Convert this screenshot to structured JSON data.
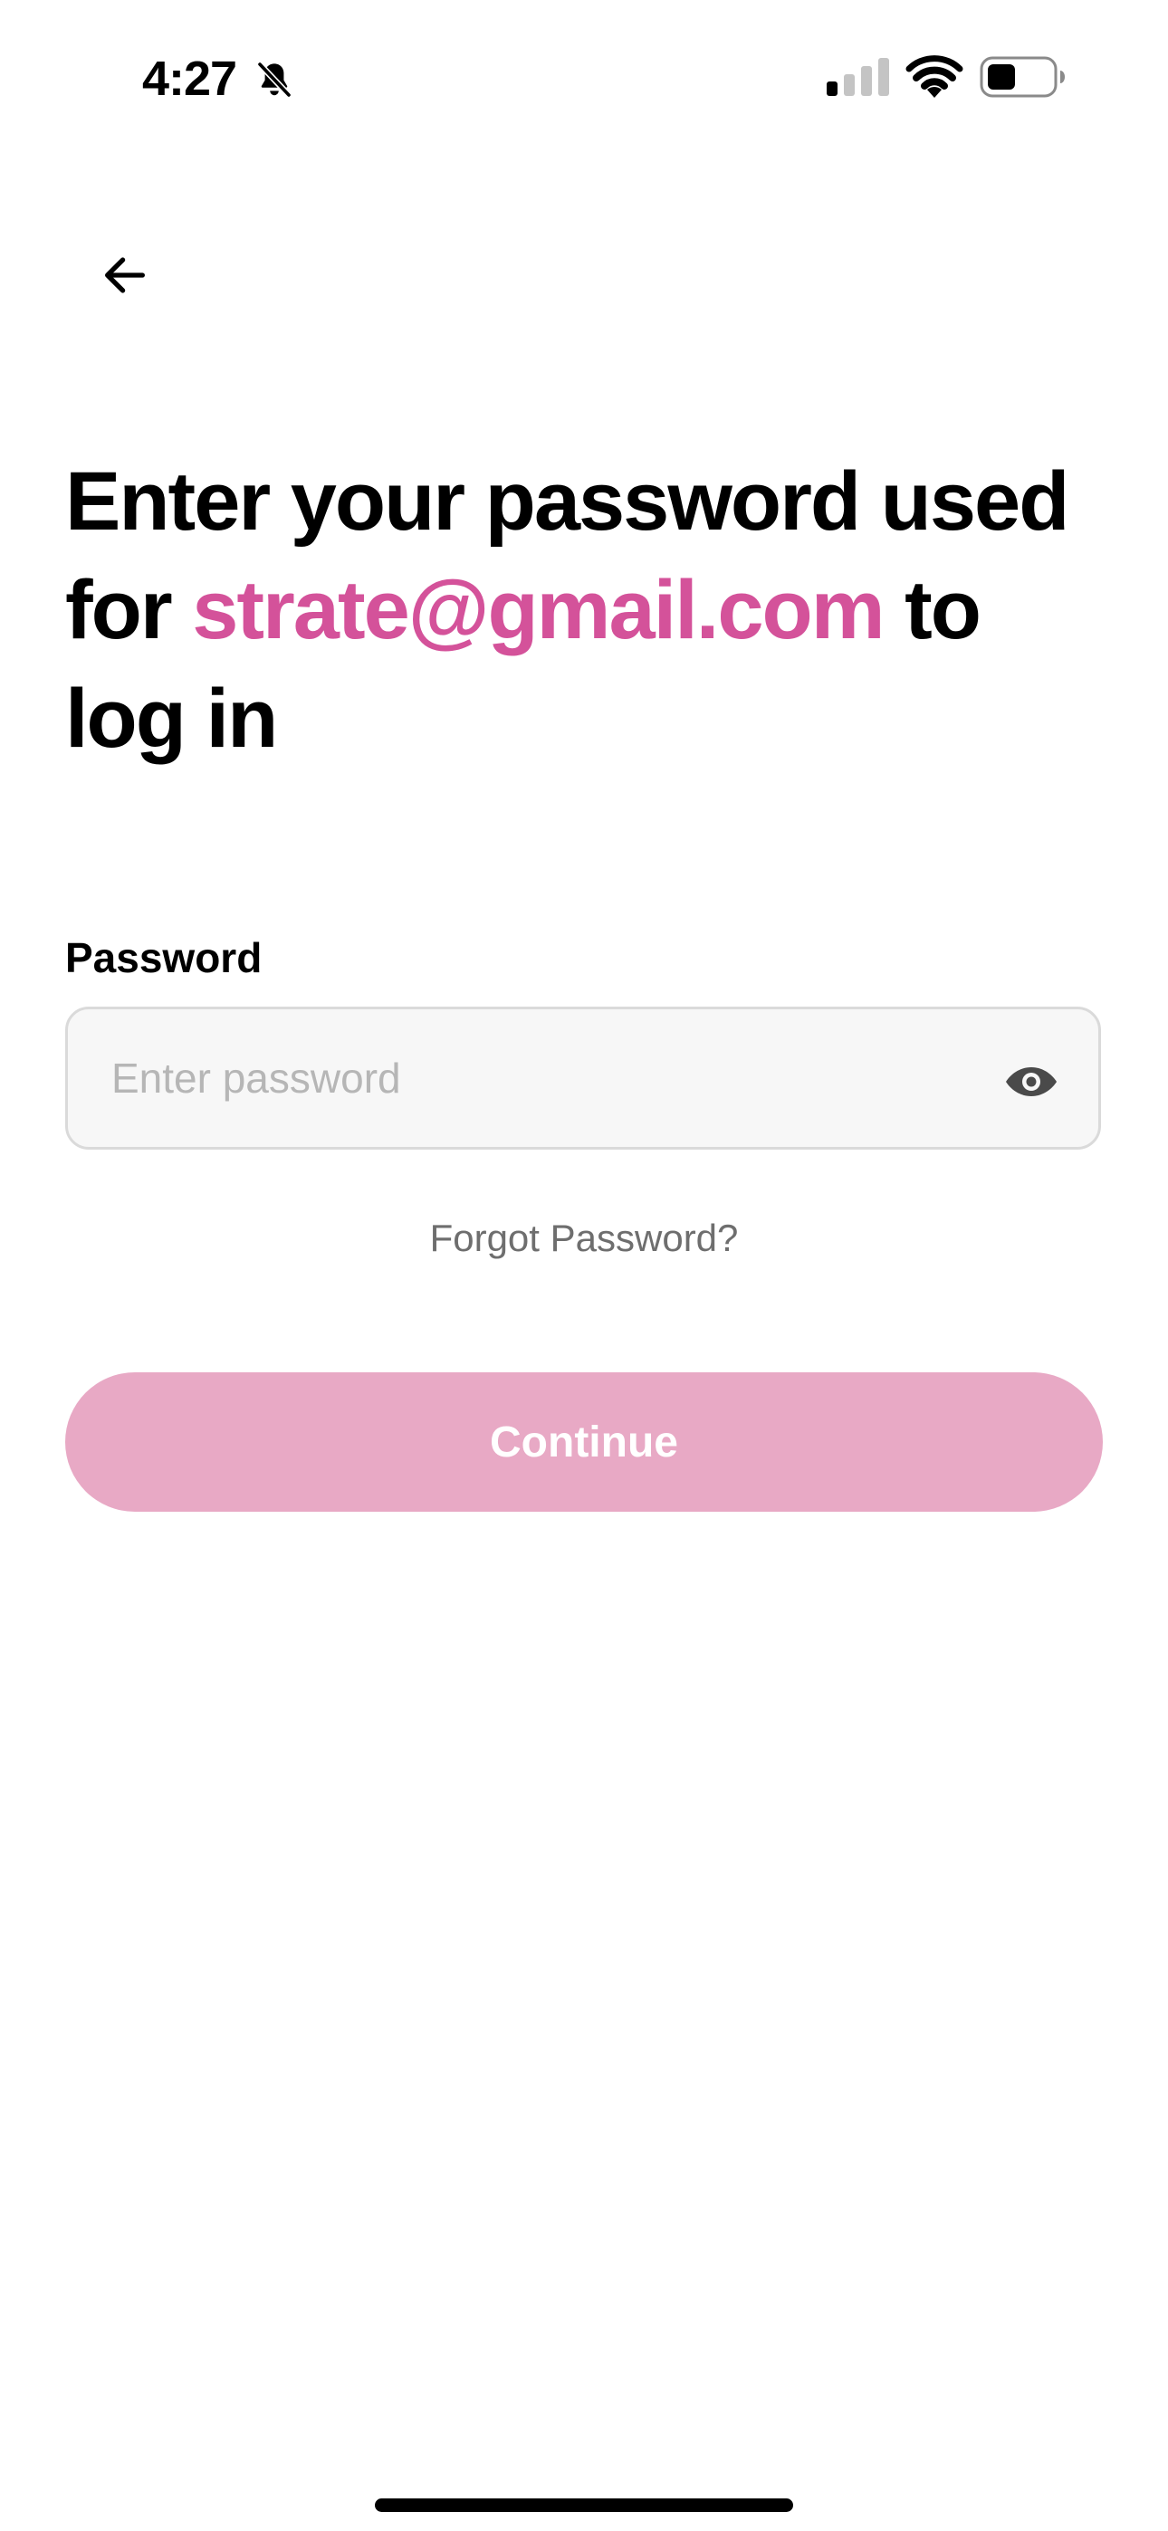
{
  "status_bar": {
    "time": "4:27",
    "icons": [
      "bell-slash-icon",
      "cellular-signal-icon",
      "wifi-icon",
      "battery-icon"
    ]
  },
  "header": {
    "back_icon": "arrow-left-icon"
  },
  "heading": {
    "line_prefix": "Enter your password used for",
    "email": "strate@gmail.com",
    "line_suffix": "to log in"
  },
  "form": {
    "password_label": "Password",
    "password_placeholder": "Enter password",
    "password_value": "",
    "visibility_icon": "eye-icon",
    "forgot_label": "Forgot Password?",
    "continue_label": "Continue"
  },
  "colors": {
    "accent": "#d4529a",
    "button_disabled": "#e8a9c5",
    "field_background": "#f7f7f7",
    "field_border": "#dadada",
    "muted_text": "#6e6e6e"
  }
}
